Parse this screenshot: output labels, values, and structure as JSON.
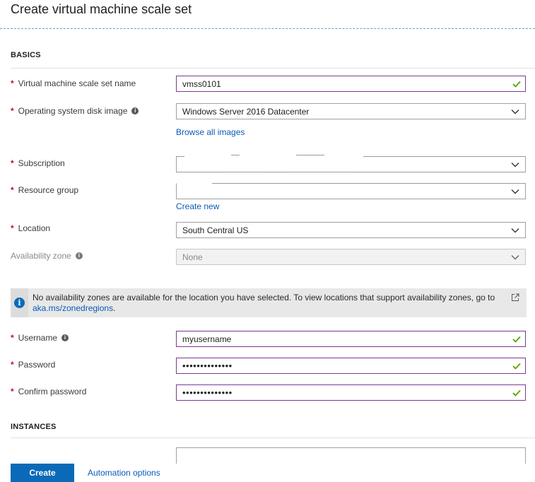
{
  "page": {
    "title": "Create virtual machine scale set"
  },
  "basics": {
    "section_title": "BASICS",
    "vmss_name": {
      "label": "Virtual machine scale set name",
      "value": "vmss0101"
    },
    "os_image": {
      "label": "Operating system disk image",
      "value": "Windows Server 2016 Datacenter",
      "link": "Browse all images"
    },
    "subscription": {
      "label": "Subscription",
      "value": ""
    },
    "resource_group": {
      "label": "Resource group",
      "value": "",
      "link": "Create new"
    },
    "location": {
      "label": "Location",
      "value": "South Central US"
    },
    "availability_zone": {
      "label": "Availability zone",
      "value": "None"
    },
    "info_banner": {
      "text": "No availability zones are available for the location you have selected. To view locations that support availability zones, go to",
      "link": "aka.ms/zonedregions",
      "suffix": "."
    },
    "username": {
      "label": "Username",
      "value": "myusername"
    },
    "password": {
      "label": "Password",
      "value": "••••••••••••••"
    },
    "confirm_password": {
      "label": "Confirm password",
      "value": "••••••••••••••"
    }
  },
  "instances": {
    "section_title": "INSTANCES"
  },
  "footer": {
    "create_label": "Create",
    "automation_label": "Automation options"
  },
  "colors": {
    "accent": "#0a6ab8",
    "valid_border": "#7a3b8f",
    "valid_check": "#57a300",
    "required": "#c50f1f"
  }
}
